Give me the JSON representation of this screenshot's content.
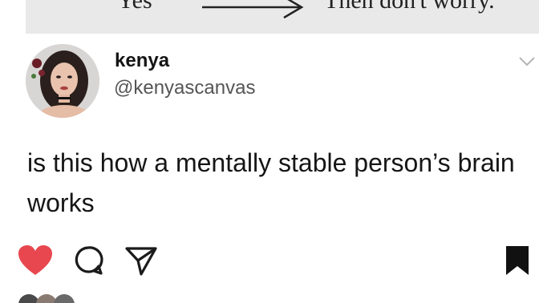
{
  "flowchart_snippet": {
    "left_label": "Yes",
    "right_label": "Then don't worry."
  },
  "post": {
    "display_name": "kenya",
    "handle": "@kenyascanvas",
    "text": "is this how a mentally stable person’s brain works",
    "liked": true
  },
  "actions": {
    "like_icon": "heart-filled-icon",
    "comment_icon": "comment-bubble-icon",
    "share_icon": "paper-plane-icon",
    "save_icon": "bookmark-filled-icon",
    "like_color": "#e8474f"
  }
}
